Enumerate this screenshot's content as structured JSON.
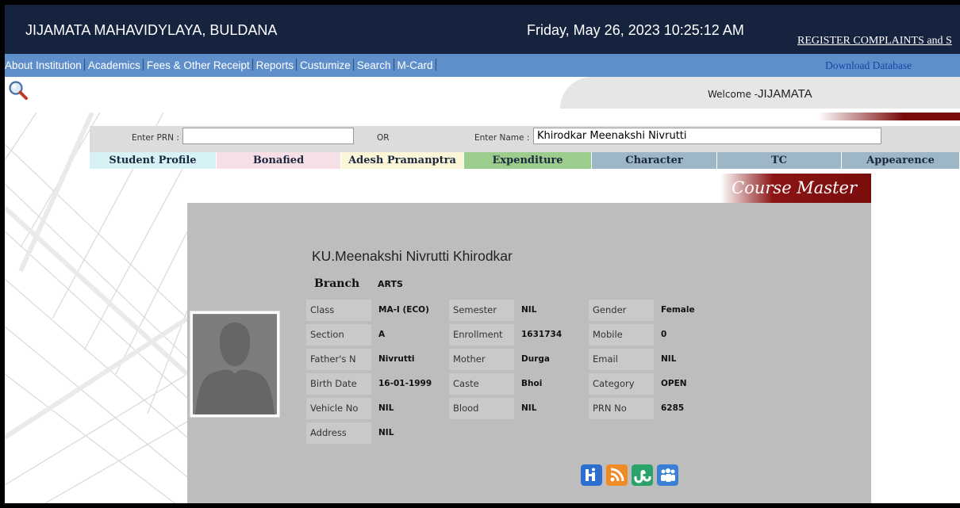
{
  "header": {
    "institution": "JIJAMATA MAHAVIDYLAYA, BULDANA",
    "datetime": "Friday, May 26, 2023 10:25:12 AM",
    "register_link": "REGISTER COMPLAINTS and S"
  },
  "menu": {
    "items": [
      "About Institution",
      "Academics",
      "Fees & Other Receipt",
      "Reports",
      "Custumize",
      "Search",
      "M-Card"
    ],
    "download": "Download Database"
  },
  "welcome": {
    "prefix": "Welcome -",
    "user": "JIJAMATA"
  },
  "search": {
    "prn_label": "Enter PRN :",
    "prn_value": "",
    "or_label": "OR",
    "name_label": "Enter Name :",
    "name_value": "Khirodkar Meenakshi Nivrutti"
  },
  "tabs": [
    {
      "label": "Student Profile",
      "color": "#d7f2f5"
    },
    {
      "label": "Bonafied",
      "color": "#f7dfe6"
    },
    {
      "label": "Adesh Pramanptra",
      "color": "#fbf6d8"
    },
    {
      "label": "Expenditure",
      "color": "#9dcd8c"
    },
    {
      "label": "Character",
      "color": "#9db7c6"
    },
    {
      "label": "TC",
      "color": "#9db7c6"
    },
    {
      "label": "Appearence",
      "color": "#9db7c6"
    }
  ],
  "course_master": "Course Master",
  "student": {
    "name": "KU.Meenakshi Nivrutti Khirodkar",
    "branch_label": "Branch",
    "branch": "ARTS",
    "fields": [
      [
        {
          "label": "Class",
          "value": "MA-I (ECO)"
        },
        {
          "label": "Semester",
          "value": "NIL"
        },
        {
          "label": "Gender",
          "value": "Female"
        }
      ],
      [
        {
          "label": "Section",
          "value": "A"
        },
        {
          "label": "Enrollment",
          "value": "1631734"
        },
        {
          "label": "Mobile",
          "value": "0"
        }
      ],
      [
        {
          "label": "Father's N",
          "value": "Nivrutti"
        },
        {
          "label": "Mother",
          "value": "Durga"
        },
        {
          "label": "Email",
          "value": "NIL"
        }
      ],
      [
        {
          "label": "Birth Date",
          "value": "16-01-1999"
        },
        {
          "label": "Caste",
          "value": "Bhoi"
        },
        {
          "label": "Category",
          "value": "OPEN"
        }
      ],
      [
        {
          "label": "Vehicle No",
          "value": "NIL"
        },
        {
          "label": "Blood",
          "value": "NIL"
        },
        {
          "label": "PRN No",
          "value": "6285"
        }
      ],
      [
        {
          "label": "Address",
          "value": "NIL"
        }
      ]
    ]
  },
  "social_icons": [
    "hi5-icon",
    "rss-icon",
    "stumbleupon-icon",
    "myspace-icon"
  ],
  "colors": {
    "header_bg": "#15233f",
    "menu_bg": "#5f8fcb",
    "panel_bg": "#bdbdbd",
    "maroon": "#7a0c0c"
  }
}
